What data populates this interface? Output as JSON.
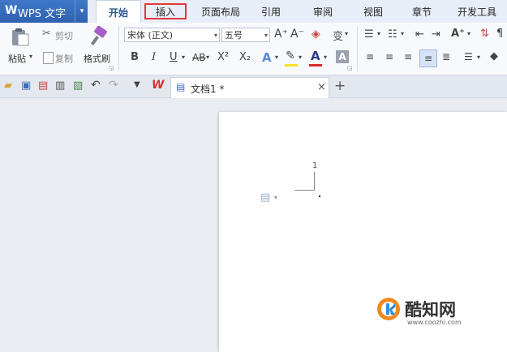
{
  "app": {
    "logo": "W",
    "title": "WPS 文字",
    "menu_arrow": "▾"
  },
  "tabs": [
    {
      "label": "开始"
    },
    {
      "label": "插入"
    },
    {
      "label": "页面布局"
    },
    {
      "label": "引用"
    },
    {
      "label": "审阅"
    },
    {
      "label": "视图"
    },
    {
      "label": "章节"
    },
    {
      "label": "开发工具"
    }
  ],
  "ribbon": {
    "paste_label": "粘贴",
    "cut_label": "剪切",
    "copy_label": "复制",
    "format_painter_label": "格式刷",
    "font_name": "宋体 (正文)",
    "font_size": "五号",
    "bold": "B",
    "italic": "I",
    "underline": "U",
    "strike": "AB",
    "superscript": "X²",
    "subscript": "X₂",
    "font_color_glyph": "A",
    "grow_font": "A⁺",
    "shrink_font": "A⁻",
    "phonetic": "变",
    "style_glyph": "A",
    "shade_glyph": "A"
  },
  "document": {
    "tab_title": "文档1 *",
    "close_glyph": "×",
    "new_tab_glyph": "+",
    "page_number": "1"
  },
  "watermark": {
    "brand": "酷知网",
    "url": "www.coozhi.com"
  },
  "colors": {
    "accent": "#2b579a",
    "app_button": "#2f62b0",
    "highlight_box": "#e0393e",
    "highlighter_yellow": "#f5e12a",
    "font_red": "#d62c2c",
    "wps_red": "#d9302c"
  }
}
